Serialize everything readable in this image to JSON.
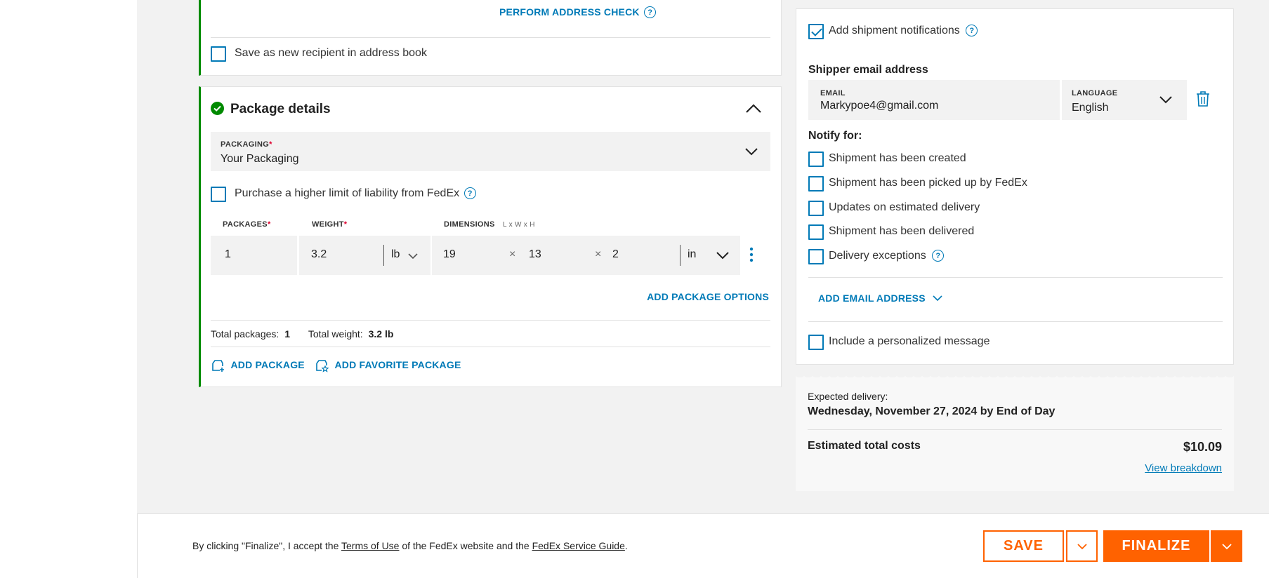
{
  "address": {
    "perform_check": "PERFORM ADDRESS CHECK",
    "save_recipient": "Save as new recipient in address book"
  },
  "package": {
    "title": "Package details",
    "packaging_label": "PACKAGING",
    "packaging_value": "Your Packaging",
    "liability_label": "Purchase a higher limit of liability from FedEx",
    "packages_label": "PACKAGES",
    "weight_label": "WEIGHT",
    "dimensions_label": "DIMENSIONS",
    "dimensions_hint": "L x W x H",
    "packages_value": "1",
    "weight_value": "3.2",
    "weight_unit": "lb",
    "dim_l": "19",
    "dim_w": "13",
    "dim_h": "2",
    "dim_times": "×",
    "dim_unit": "in",
    "add_options": "ADD PACKAGE OPTIONS",
    "total_packages_label": "Total packages:",
    "total_packages_value": "1",
    "total_weight_label": "Total weight:",
    "total_weight_value": "3.2 lb",
    "add_package": "ADD PACKAGE",
    "add_favorite": "ADD FAVORITE PACKAGE"
  },
  "notifications": {
    "add_label": "Add shipment notifications",
    "shipper_email_title": "Shipper email address",
    "email_label": "EMAIL",
    "email_value": "Markypoe4@gmail.com",
    "language_label": "LANGUAGE",
    "language_value": "English",
    "notify_for": "Notify for:",
    "options": [
      "Shipment has been created",
      "Shipment has been picked up by FedEx",
      "Updates on estimated delivery",
      "Shipment has been delivered",
      "Delivery exceptions"
    ],
    "add_email": "ADD EMAIL ADDRESS",
    "personal_message": "Include a personalized message"
  },
  "summary": {
    "expected_label": "Expected delivery:",
    "expected_value": "Wednesday, November 27, 2024 by End of Day",
    "total_label": "Estimated total costs",
    "total_value": "$10.09",
    "breakdown": "View breakdown"
  },
  "footer": {
    "text_before": "By clicking \"Finalize\", I accept the ",
    "terms": "Terms of Use",
    "text_middle": " of the FedEx website and the ",
    "guide": "FedEx Service Guide",
    "text_after": ".",
    "save": "SAVE",
    "finalize": "FINALIZE"
  },
  "colors": {
    "fedex_orange": "#ff6200",
    "link_blue": "#007ab7",
    "success_green": "#008a00"
  }
}
